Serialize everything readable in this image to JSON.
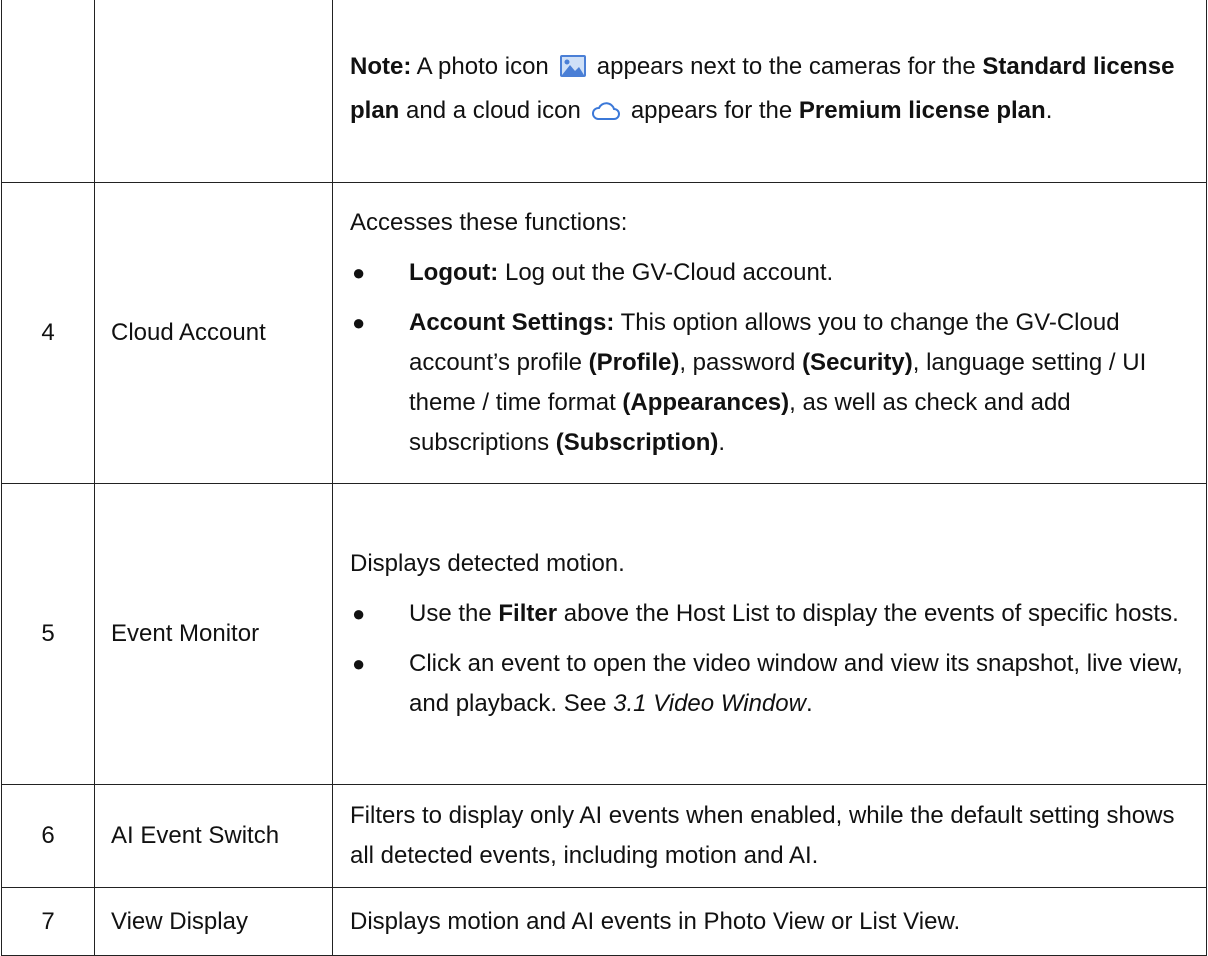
{
  "row_note": {
    "num": "",
    "name": "",
    "note_label": "Note:",
    "t1": " A photo icon",
    "t2": "appears next to the cameras for the",
    "std_plan": "Standard license plan",
    "t3": " and a cloud icon",
    "t4": "appears for the",
    "prem_plan": "Premium license plan",
    "t5": ".",
    "icons": [
      "photo-icon",
      "cloud-icon"
    ]
  },
  "row4": {
    "num": "4",
    "name": "Cloud Account",
    "intro": "Accesses these functions:",
    "b1_label": "Logout:",
    "b1_text": " Log out the GV-Cloud account.",
    "b2_label": "Account Settings:",
    "b2_t1": " This option allows you to change the GV-Cloud account’s profile ",
    "b2_p1": "(Profile)",
    "b2_t2": ", password ",
    "b2_p2": "(Security)",
    "b2_t3": ", language setting / UI theme / time format ",
    "b2_p3": "(Appearances)",
    "b2_t4": ", as well as check and add subscriptions ",
    "b2_p4": "(Subscription)",
    "b2_t5": "."
  },
  "row5": {
    "num": "5",
    "name": "Event Monitor",
    "intro": "Displays detected motion.",
    "b1_t1": "Use the ",
    "b1_bold": "Filter",
    "b1_t2": " above the Host List to display the events of specific hosts.",
    "b2_t1": "Click an event to open the video window and view its snapshot, live view, and playback. See ",
    "b2_ital": "3.1 Video Window",
    "b2_t2": "."
  },
  "row6": {
    "num": "6",
    "name": "AI Event Switch",
    "desc": "Filters to display only AI events when enabled, while the default setting shows all detected events, including motion and AI."
  },
  "row7": {
    "num": "7",
    "name": "View Display",
    "desc": "Displays motion and AI events in Photo View or List View."
  },
  "bullet_char": "●",
  "colors": {
    "photo_icon": "#4a7fd6",
    "cloud_icon": "#3b78d8",
    "border": "#222222"
  }
}
